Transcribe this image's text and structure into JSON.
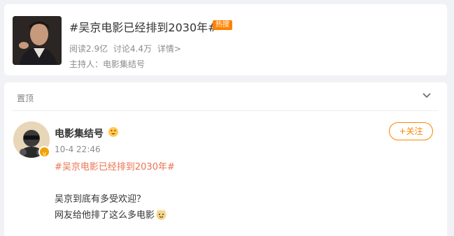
{
  "topic": {
    "title": "#吴京电影已经排到2030年#",
    "hot_badge": "热搜",
    "reads": "阅读2.9亿",
    "discussions": "讨论4.4万",
    "details": "详情>",
    "host": "主持人：电影集结号"
  },
  "feed": {
    "pinned_label": "置顶",
    "collapse_icon": "chevron-down-icon"
  },
  "post": {
    "user_name": "电影集结号",
    "time": "10-4 22:46",
    "follow_label": "+关注",
    "topic_link": "#吴京电影已经排到2030年#",
    "line1": "吴京到底有多受欢迎？",
    "line2": "网友给他排了这么多电影"
  },
  "colors": {
    "accent": "#ff8200",
    "topic_link": "#eb7350",
    "background": "#f1f2f5"
  }
}
